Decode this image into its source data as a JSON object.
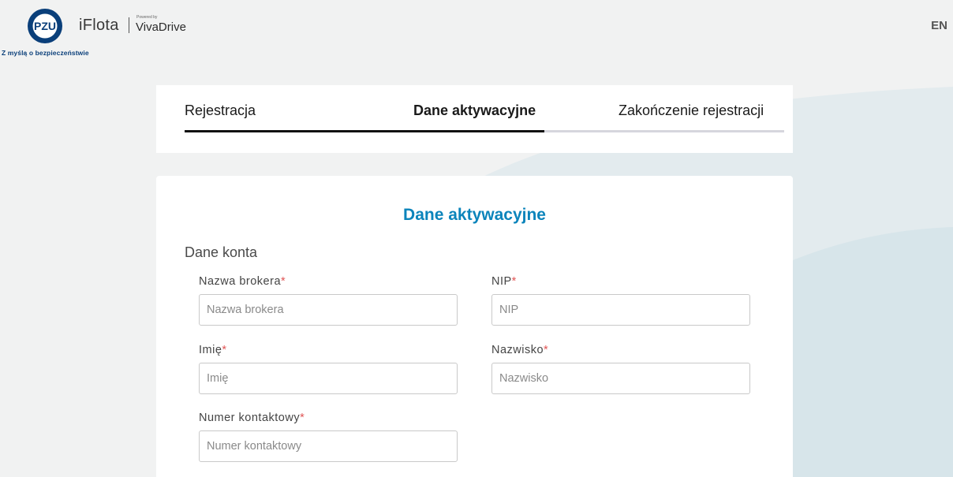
{
  "header": {
    "tagline": "Z myślą o bezpieczeństwie",
    "app_title": "iFlota",
    "partner_small": "Powered by",
    "partner_name": "VivaDrive",
    "language": "EN"
  },
  "stepper": {
    "steps": [
      {
        "label": "Rejestracja"
      },
      {
        "label": "Dane aktywacyjne"
      },
      {
        "label": "Zakończenie rejestracji"
      }
    ],
    "progress_fraction": 0.6
  },
  "form": {
    "title": "Dane aktywacyjne",
    "section": "Dane konta",
    "required_mark": "*",
    "fields": [
      {
        "label": "Nazwa brokera",
        "placeholder": "Nazwa brokera",
        "value": ""
      },
      {
        "label": "NIP",
        "placeholder": "NIP",
        "value": ""
      },
      {
        "label": "Imię",
        "placeholder": "Imię",
        "value": ""
      },
      {
        "label": "Nazwisko",
        "placeholder": "Nazwisko",
        "value": ""
      },
      {
        "label": "Numer kontaktowy",
        "placeholder": "Numer kontaktowy",
        "value": ""
      }
    ]
  },
  "colors": {
    "accent": "#0b84bb",
    "brand_blue": "#0a3f7a",
    "required": "#e05555"
  }
}
